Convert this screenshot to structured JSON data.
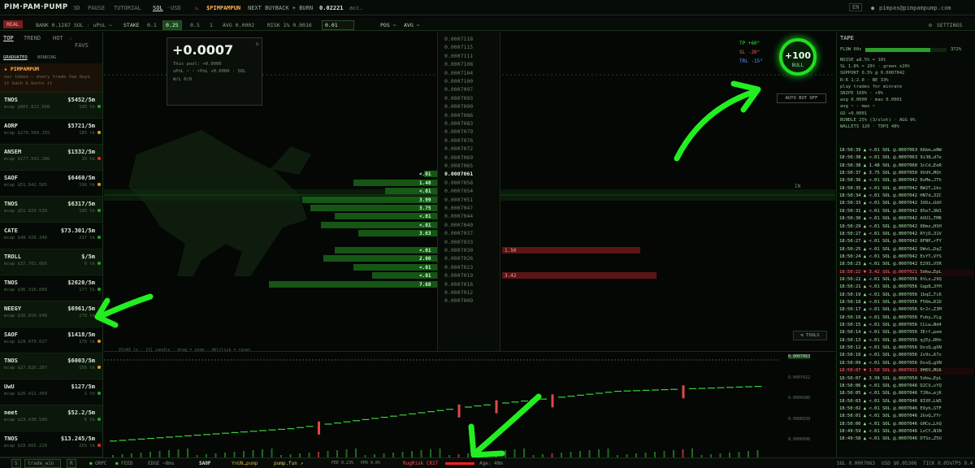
{
  "header": {
    "logo": "PIM·PAM·PUMP",
    "nav": [
      "3D",
      "PAUSE",
      "TUTORIAL"
    ],
    "currency": [
      "SOL",
      "USD"
    ],
    "token": "$PIMPAMPUN",
    "buyback_label": "NEXT BUYBACK + BURN",
    "buyback_value": "0.02221",
    "buyback_suffix": "acc.",
    "lang": "EN",
    "user": "pimpas@pimpampump.com"
  },
  "toolbar": {
    "mode": "REAL",
    "bank": "BANK 0.1287 SOL · uPnL ~",
    "stake_label": "STAKE",
    "stakes": [
      "0.1",
      "0.25",
      "0.5",
      "1"
    ],
    "avg": "AVG 0.0002",
    "risk": "RISK 1% 0.0016",
    "input": "0.01",
    "pos": "POS ~",
    "avg2": "AVG ~",
    "settings": "SETTINGS"
  },
  "left": {
    "tabs": [
      "TOP",
      "TREND",
      "HOT",
      "FAVS"
    ],
    "subtabs": [
      "GRADUATED",
      "BONDING"
    ],
    "promo_title": "★ PIMPAMPUM",
    "promo_text": "our token — every trade fee buys it back & burns it",
    "coins": [
      {
        "name": "TNOS",
        "price": "$5452/5m",
        "mcap": "mcap $805.812.608",
        "tk": "195 tk"
      },
      {
        "name": "AORP",
        "price": "$5721/5m",
        "mcap": "mcap $270.560.155",
        "tk": "185 tk"
      },
      {
        "name": "ANSEM",
        "price": "$1532/5m",
        "mcap": "mcap $177.502.286",
        "tk": "15 tk"
      },
      {
        "name": "SAOF",
        "price": "$6460/5m",
        "mcap": "mcap $51.942.565",
        "tk": "196 tk"
      },
      {
        "name": "TNOS",
        "price": "$6317/5m",
        "mcap": "mcap $51.829.530",
        "tk": "195 tk"
      },
      {
        "name": "CATE",
        "price": "$73.301/5m",
        "mcap": "mcap $48.420.349",
        "tk": "217 tk"
      },
      {
        "name": "TROLL",
        "price": "$/5m",
        "mcap": "mcap $37.701.665",
        "tk": "0 tk"
      },
      {
        "name": "TNOS",
        "price": "$2620/5m",
        "mcap": "mcap $36.316.089",
        "tk": "177 tk"
      },
      {
        "name": "NEEGY",
        "price": "$6961/5m",
        "mcap": "mcap $30.650.948",
        "tk": "178 tk"
      },
      {
        "name": "SAOF",
        "price": "$1418/5m",
        "mcap": "mcap $28.479.027",
        "tk": "176 tk"
      },
      {
        "name": "TNOS",
        "price": "$6003/5m",
        "mcap": "mcap $27.826.207",
        "tk": "156 tk"
      },
      {
        "name": "UwU",
        "price": "$127/5m",
        "mcap": "mcap $26.411.450",
        "tk": "1 th"
      },
      {
        "name": "neet",
        "price": "$52.2/5m",
        "mcap": "mcap $23.430.580",
        "tk": "6 tk"
      },
      {
        "name": "TNOS",
        "price": "$13.245/5m",
        "mcap": "mcap $18.665.229",
        "tk": "255 tk"
      }
    ]
  },
  "pnl": {
    "value": "+0.0007",
    "pool": "This pool: +0.0000",
    "upnl": "uPnL ~ · rPnL +0.0000 · SOL",
    "wl": "W/L 0/0"
  },
  "ladder": {
    "prices": [
      "0.0007118",
      "0.0007115",
      "0.0007111",
      "0.0007108",
      "0.0007104",
      "0.0007100",
      "0.0007097",
      "0.0007093",
      "0.0007090",
      "0.0007086",
      "0.0007083",
      "0.0007079",
      "0.0007076",
      "0.0007072",
      "0.0007069",
      "0.0007065",
      "0.0007061",
      "0.0007058",
      "0.0007054",
      "0.0007051",
      "0.0007047",
      "0.0007044",
      "0.0007040",
      "0.0007037",
      "0.0007033",
      "0.0007030",
      "0.0007026",
      "0.0007023",
      "0.0007019",
      "0.0007016",
      "0.0007012",
      "0.0007009"
    ],
    "current_index": 16,
    "bids": [
      {
        "index": 16,
        "label": "<.01",
        "size": 0.07
      },
      {
        "index": 17,
        "label": "1.48",
        "size": 0.45
      },
      {
        "index": 18,
        "label": "<.01",
        "size": 0.28
      },
      {
        "index": 19,
        "label": "3.99",
        "size": 0.72
      },
      {
        "index": 20,
        "label": "3.75",
        "size": 0.68
      },
      {
        "index": 21,
        "label": "<.01",
        "size": 0.55
      },
      {
        "index": 22,
        "label": "<.01",
        "size": 0.62
      },
      {
        "index": 23,
        "label": "3.63",
        "size": 0.42
      },
      {
        "index": 25,
        "label": "<.01",
        "size": 0.55
      },
      {
        "index": 26,
        "label": "2.00",
        "size": 0.61
      },
      {
        "index": 27,
        "label": "<.01",
        "size": 0.45
      },
      {
        "index": 28,
        "label": "<.01",
        "size": 0.35
      },
      {
        "index": 29,
        "label": "7.68",
        "size": 0.9
      }
    ],
    "asks": [
      {
        "index": 25,
        "label": "1.50",
        "size": 0.85
      },
      {
        "index": 28,
        "label": "3.42",
        "size": 0.95
      }
    ],
    "in_label": "IN"
  },
  "bot": {
    "tp": "TP +60°",
    "sl": "SL -20°",
    "trl": "TRL -15°",
    "score": "+100",
    "mood": "BULL",
    "auto": "AUTO BOT OFF",
    "tools": "TOOLS"
  },
  "chart": {
    "legend": "VStAS lx · [V] candle · drag = zoom · dblclick = reset",
    "ticks": [
      "0.0007063",
      "0.0007022",
      "0.0006980",
      "0.0006939",
      "0.0006898"
    ]
  },
  "tape": {
    "title": "TAPE",
    "flow": "FLOW 60s",
    "flow_pct": "372%",
    "params": [
      "NOISE ±8.5% ≈ 10t",
      "SL 1.8% ≈ 20t · green x20t",
      "SUPPORT 0.5% @ 0.0007042",
      "R:R 1:2.0 · BE 33%",
      "play trades for minrate",
      "SNIPE 100% · +0%",
      "avg 0.0000 · max 0.0001",
      "avg ~ · max ~",
      "GO +0.0001",
      "BUNDLE 25% (3/slot) · AGG 0%",
      "WALLETS 120 · TOP3 48%"
    ],
    "trades": [
      {
        "t": "18:50:39",
        "s": "b",
        "amt": "<.01",
        "px": "@.0007063",
        "w": "6Akm…eNW"
      },
      {
        "t": "18:50:38",
        "s": "b",
        "amt": "<.01",
        "px": "@.0007063",
        "w": "9i38…d7e"
      },
      {
        "t": "18:50:38",
        "s": "b",
        "amt": "1.48",
        "px": "@.0007060",
        "w": "3cCd…EeR"
      },
      {
        "t": "18:50:37",
        "s": "b",
        "amt": "3.75",
        "px": "@.0007050",
        "w": "9VdV…MQt"
      },
      {
        "t": "18:50:36",
        "s": "b",
        "amt": "<.01",
        "px": "@.0007042",
        "w": "BzMe…JTh"
      },
      {
        "t": "18:50:35",
        "s": "b",
        "amt": "<.01",
        "px": "@.0007042",
        "w": "BW2T…1bc"
      },
      {
        "t": "18:50:34",
        "s": "b",
        "amt": "<.01",
        "px": "@.0007042",
        "w": "HN7d…3ZC"
      },
      {
        "t": "18:50:33",
        "s": "b",
        "amt": "<.01",
        "px": "@.0007042",
        "w": "3XDz…UdX"
      },
      {
        "t": "18:50:31",
        "s": "b",
        "amt": "<.01",
        "px": "@.0007042",
        "w": "85e7…9W1"
      },
      {
        "t": "18:50:30",
        "s": "b",
        "amt": "<.01",
        "px": "@.0007042",
        "w": "AXU1…TMR"
      },
      {
        "t": "18:50:29",
        "s": "b",
        "amt": "<.01",
        "px": "@.0007042",
        "w": "88mz…HSH"
      },
      {
        "t": "18:50:27",
        "s": "b",
        "amt": "<.01",
        "px": "@.0007042",
        "w": "RYjD…31V"
      },
      {
        "t": "18:50:27",
        "s": "b",
        "amt": "<.01",
        "px": "@.0007042",
        "w": "8FNP…rFY"
      },
      {
        "t": "18:50:25",
        "s": "b",
        "amt": "<.01",
        "px": "@.0007042",
        "w": "DWvL…DqZ"
      },
      {
        "t": "18:50:24",
        "s": "b",
        "amt": "<.01",
        "px": "@.0007042",
        "w": "EsYT…VYS"
      },
      {
        "t": "18:50:23",
        "s": "b",
        "amt": "<.01",
        "px": "@.0007042",
        "w": "E29S…V5R"
      },
      {
        "t": "18:50:22",
        "s": "s",
        "amt": "3.42",
        "px": "@.0007021",
        "w": "5dkw…EpL"
      },
      {
        "t": "18:50:22",
        "s": "b",
        "amt": "<.01",
        "px": "@.0007056",
        "w": "6tLz…29Q"
      },
      {
        "t": "18:50:21",
        "s": "b",
        "amt": "<.01",
        "px": "@.0007056",
        "w": "Gqp8…3YH"
      },
      {
        "t": "18:50:19",
        "s": "b",
        "amt": "<.01",
        "px": "@.0007056",
        "w": "1bqZ…Ti6"
      },
      {
        "t": "18:50:18",
        "s": "b",
        "amt": "<.01",
        "px": "@.0007056",
        "w": "F56m…R1D"
      },
      {
        "t": "18:50:17",
        "s": "b",
        "amt": "<.01",
        "px": "@.0007056",
        "w": "6r2r…Z3M"
      },
      {
        "t": "18:50:16",
        "s": "b",
        "amt": "<.01",
        "px": "@.0007056",
        "w": "Fuby…YLg"
      },
      {
        "t": "18:50:15",
        "s": "b",
        "amt": "<.01",
        "px": "@.0007056",
        "w": "CLLw…Nd4"
      },
      {
        "t": "18:50:14",
        "s": "b",
        "amt": "<.01",
        "px": "@.0007056",
        "w": "3Erf…pem"
      },
      {
        "t": "18:50:13",
        "s": "b",
        "amt": "<.01",
        "px": "@.0007056",
        "w": "qjEy…RHn"
      },
      {
        "t": "18:50:12",
        "s": "b",
        "amt": "<.01",
        "px": "@.0007056",
        "w": "DssQ…gXN"
      },
      {
        "t": "18:50:10",
        "s": "b",
        "amt": "<.01",
        "px": "@.0007056",
        "w": "2v9s…67x"
      },
      {
        "t": "18:50:09",
        "s": "b",
        "amt": "<.01",
        "px": "@.0007056",
        "w": "DssQ…gXN"
      },
      {
        "t": "18:50:07",
        "s": "s",
        "amt": "1.50",
        "px": "@.0007031",
        "w": "9H6V…MG6"
      },
      {
        "t": "18:50:07",
        "s": "b",
        "amt": "3.99",
        "px": "@.0007050",
        "w": "5dkw…EpL"
      },
      {
        "t": "18:50:06",
        "s": "b",
        "amt": "<.01",
        "px": "@.0007046",
        "w": "D2CV…vYQ"
      },
      {
        "t": "18:50:05",
        "s": "b",
        "amt": "<.01",
        "px": "@.0007046",
        "w": "TJRo…ejK"
      },
      {
        "t": "18:50:03",
        "s": "b",
        "amt": "<.01",
        "px": "@.0007046",
        "w": "8IXP…LWS"
      },
      {
        "t": "18:50:02",
        "s": "b",
        "amt": "<.01",
        "px": "@.0007046",
        "w": "E9yh…STF"
      },
      {
        "t": "18:50:01",
        "s": "b",
        "amt": "<.01",
        "px": "@.0007046",
        "w": "2GvQ…YYr"
      },
      {
        "t": "18:50:00",
        "s": "b",
        "amt": "<.01",
        "px": "@.0007046",
        "w": "GHCo…LhQ"
      },
      {
        "t": "18:49:59",
        "s": "b",
        "amt": "<.01",
        "px": "@.0007046",
        "w": "LvCY…N1N"
      },
      {
        "t": "18:49:58",
        "s": "b",
        "amt": "<.01",
        "px": "@.0007046",
        "w": "DTSz…Z5U"
      }
    ]
  },
  "footer": {
    "s": "S",
    "select": "trade_win",
    "r": "R",
    "grpc": "GRPC",
    "feed": "FEED",
    "edge": "EDGE ~8ms",
    "pair": "SAOF",
    "pump": "YnUN…pump",
    "site": "pump.fun ↗",
    "fee": "FEE 0.23%",
    "ppd": "PPD 0.0%",
    "rug": "RugRisk CRIT",
    "age": "Age: 40m",
    "sol": "SOL 0.0007063",
    "usd": "USD $0.05306",
    "tick": "TICK 0.05%",
    "tps": "TPS 9.4"
  },
  "colors": {
    "accent": "#1fe01f",
    "bid": "#1a6a1a",
    "ask": "#6a1818"
  }
}
